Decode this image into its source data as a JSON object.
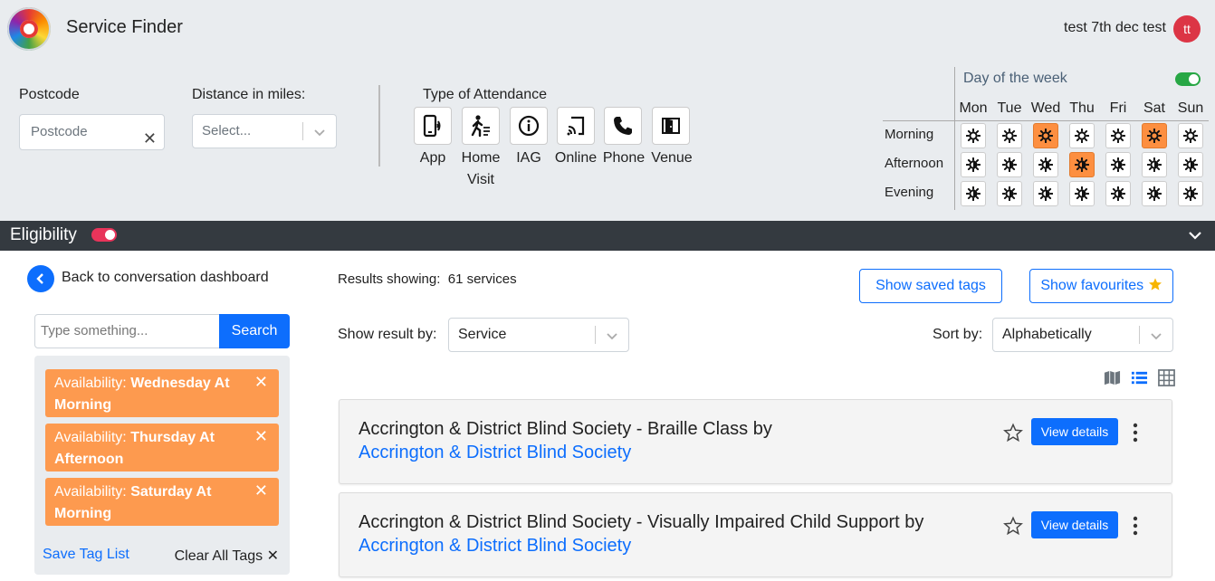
{
  "header": {
    "app_title": "Service Finder",
    "user_name": "test 7th dec test",
    "avatar_initials": "tt"
  },
  "filters": {
    "postcode_label": "Postcode",
    "postcode_placeholder": "Postcode",
    "distance_label": "Distance in miles:",
    "distance_placeholder": "Select...",
    "attendance_label": "Type of Attendance",
    "attendance": [
      {
        "label": "App",
        "icon": "phone-signal-icon"
      },
      {
        "label": "Home Visit",
        "icon": "walking-person-icon"
      },
      {
        "label": "IAG",
        "icon": "info-icon"
      },
      {
        "label": "Online",
        "icon": "cast-icon"
      },
      {
        "label": "Phone",
        "icon": "phone-icon"
      },
      {
        "label": "Venue",
        "icon": "door-icon"
      }
    ]
  },
  "week": {
    "title": "Day of the week",
    "toggle_on": true,
    "days": [
      "Mon",
      "Tue",
      "Wed",
      "Thu",
      "Fri",
      "Sat",
      "Sun"
    ],
    "slots": [
      {
        "label": "Morning",
        "selected": [
          false,
          false,
          true,
          false,
          false,
          true,
          false
        ]
      },
      {
        "label": "Afternoon",
        "selected": [
          false,
          false,
          false,
          true,
          false,
          false,
          false
        ]
      },
      {
        "label": "Evening",
        "selected": [
          false,
          false,
          false,
          false,
          false,
          false,
          false
        ]
      }
    ],
    "selected_color": "#fd8f40"
  },
  "eligibility": {
    "title": "Eligibility",
    "toggle_on": true
  },
  "sidebar": {
    "back_label": "Back to conversation dashboard",
    "search_placeholder": "Type something...",
    "search_button": "Search",
    "tags": [
      {
        "prefix": "Availability: ",
        "value": "Wednesday At Morning"
      },
      {
        "prefix": "Availability: ",
        "value": "Thursday At Afternoon"
      },
      {
        "prefix": "Availability: ",
        "value": "Saturday At Morning"
      }
    ],
    "save_tags_label": "Save Tag List",
    "clear_tags_label": "Clear All Tags"
  },
  "results": {
    "showing_label": "Results showing:",
    "showing_count": "61 services",
    "saved_tags_button": "Show saved tags",
    "favourites_button": "Show favourites",
    "show_by_label": "Show result by:",
    "show_by_value": "Service",
    "sort_label": "Sort by:",
    "sort_value": "Alphabetically",
    "view_details_label": "View details",
    "items": [
      {
        "title": "Accrington & District Blind Society - Braille Class",
        "by": " by ",
        "provider": "Accrington & District Blind Society"
      },
      {
        "title": "Accrington & District Blind Society - Visually Impaired Child Support",
        "by": " by ",
        "provider": "Accrington & District Blind Society"
      }
    ]
  },
  "colors": {
    "primary": "#0d6efd",
    "tag_orange": "#fd9a4f",
    "eligibility_bar": "#343a40",
    "toggle_green": "#28a745",
    "toggle_red": "#e8345a"
  }
}
